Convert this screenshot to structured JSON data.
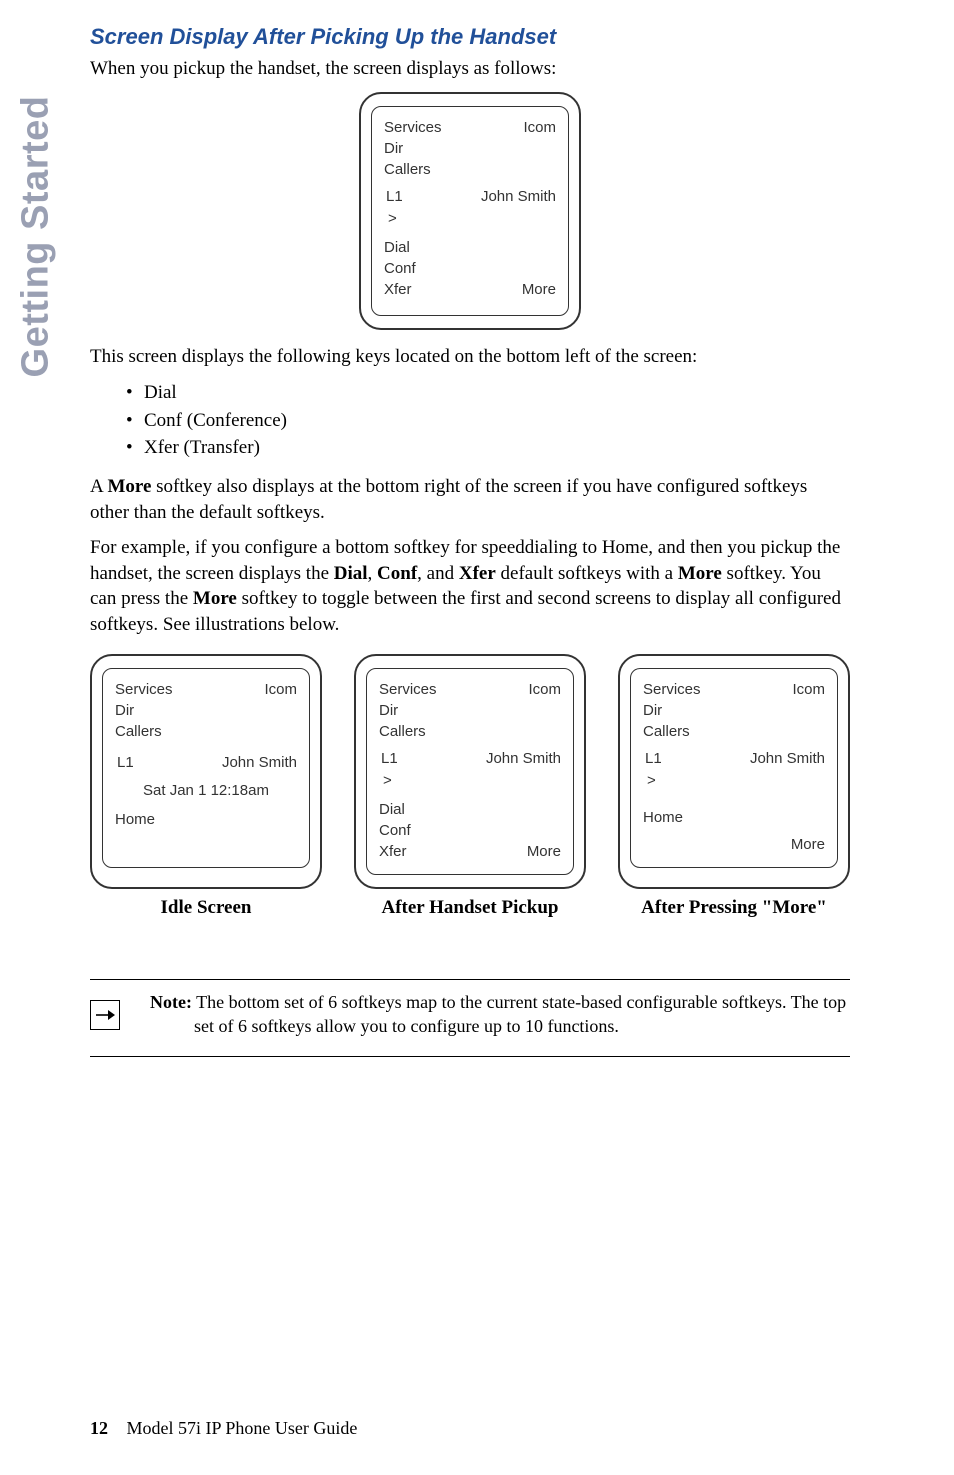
{
  "sideTab": "Getting Started",
  "sectionTitle": "Screen Display After Picking Up the Handset",
  "intro": "When you pickup the handset, the screen displays as follows:",
  "screenMain": {
    "top": {
      "services": "Services",
      "dir": "Dir",
      "callers": "Callers",
      "right": "Icom"
    },
    "mid": {
      "l1": "L1",
      "gt": ">",
      "right": "John Smith"
    },
    "bot": {
      "dial": "Dial",
      "conf": "Conf",
      "xfer": "Xfer",
      "more": "More"
    }
  },
  "afterScreens": "This screen displays the following keys located on the bottom left of the screen:",
  "bullets": [
    "Dial",
    "Conf (Conference)",
    "Xfer (Transfer)"
  ],
  "para2a": "A ",
  "para2More": "More",
  "para2b": " softkey also displays at the bottom right of the screen if you have configured softkeys other than the default softkeys.",
  "para3a": "For example, if you configure a bottom softkey for speeddialing to Home, and then you pickup the handset, the screen displays the ",
  "para3Dial": "Dial",
  "para3c": ", ",
  "para3Conf": "Conf",
  "para3d": ", and ",
  "para3Xfer": "Xfer",
  "para3e": " default softkeys with a ",
  "para3More": "More",
  "para3f": " softkey. You can press the ",
  "para3More2": "More",
  "para3g": " softkey to toggle between the first and second screens to display all configured softkeys. See illustrations below.",
  "trio": {
    "idle": {
      "top": {
        "services": "Services",
        "dir": "Dir",
        "callers": "Callers",
        "right": "Icom"
      },
      "mid": {
        "l1": "L1",
        "right": "John Smith",
        "date": "Sat Jan 1 12:18am"
      },
      "bot": {
        "home": "Home"
      }
    },
    "pickup": {
      "top": {
        "services": "Services",
        "dir": "Dir",
        "callers": "Callers",
        "right": "Icom"
      },
      "mid": {
        "l1": "L1",
        "gt": ">",
        "right": "John Smith"
      },
      "bot": {
        "dial": "Dial",
        "conf": "Conf",
        "xfer": "Xfer",
        "more": "More"
      }
    },
    "more": {
      "top": {
        "services": "Services",
        "dir": "Dir",
        "callers": "Callers",
        "right": "Icom"
      },
      "mid": {
        "l1": "L1",
        "gt": ">",
        "right": "John Smith"
      },
      "bot": {
        "home": "Home",
        "more": "More"
      }
    }
  },
  "trioLabels": {
    "idle": "Idle Screen",
    "pickup": "After Handset Pickup",
    "more": "After Pressing \"More\""
  },
  "noteLabel": "Note:",
  "noteText": " The bottom set of 6 softkeys map to the current state-based configurable softkeys. The top set of 6 softkeys allow you to configure up to 10 functions.",
  "footer": {
    "page": "12",
    "title": "Model 57i IP Phone User Guide"
  }
}
